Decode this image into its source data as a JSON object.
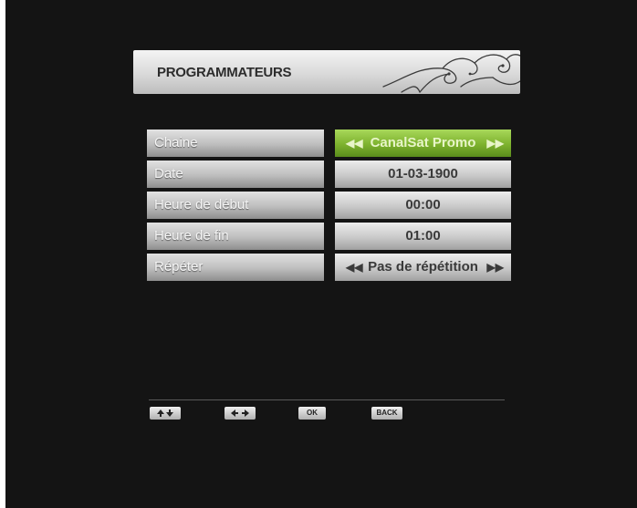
{
  "header": {
    "title": "PROGRAMMATEURS"
  },
  "rows": [
    {
      "label": "Chaine",
      "value": "CanalSat Promo",
      "arrows": true,
      "active": true
    },
    {
      "label": "Date",
      "value": "01-03-1900",
      "arrows": false,
      "active": false
    },
    {
      "label": "Heure de début",
      "value": "00:00",
      "arrows": false,
      "active": false
    },
    {
      "label": "Heure de fin",
      "value": "01:00",
      "arrows": false,
      "active": false
    },
    {
      "label": "Répéter",
      "value": "Pas de répétition",
      "arrows": true,
      "active": false
    }
  ],
  "footer": {
    "keys": [
      {
        "icon": "up-down-arrows-icon"
      },
      {
        "icon": "left-right-arrows-icon"
      },
      {
        "label": "OK"
      },
      {
        "label": "BACK"
      }
    ]
  },
  "colors": {
    "background": "#141414",
    "active_green": "#7db22e",
    "cell_gray": "#bdbdbd"
  }
}
